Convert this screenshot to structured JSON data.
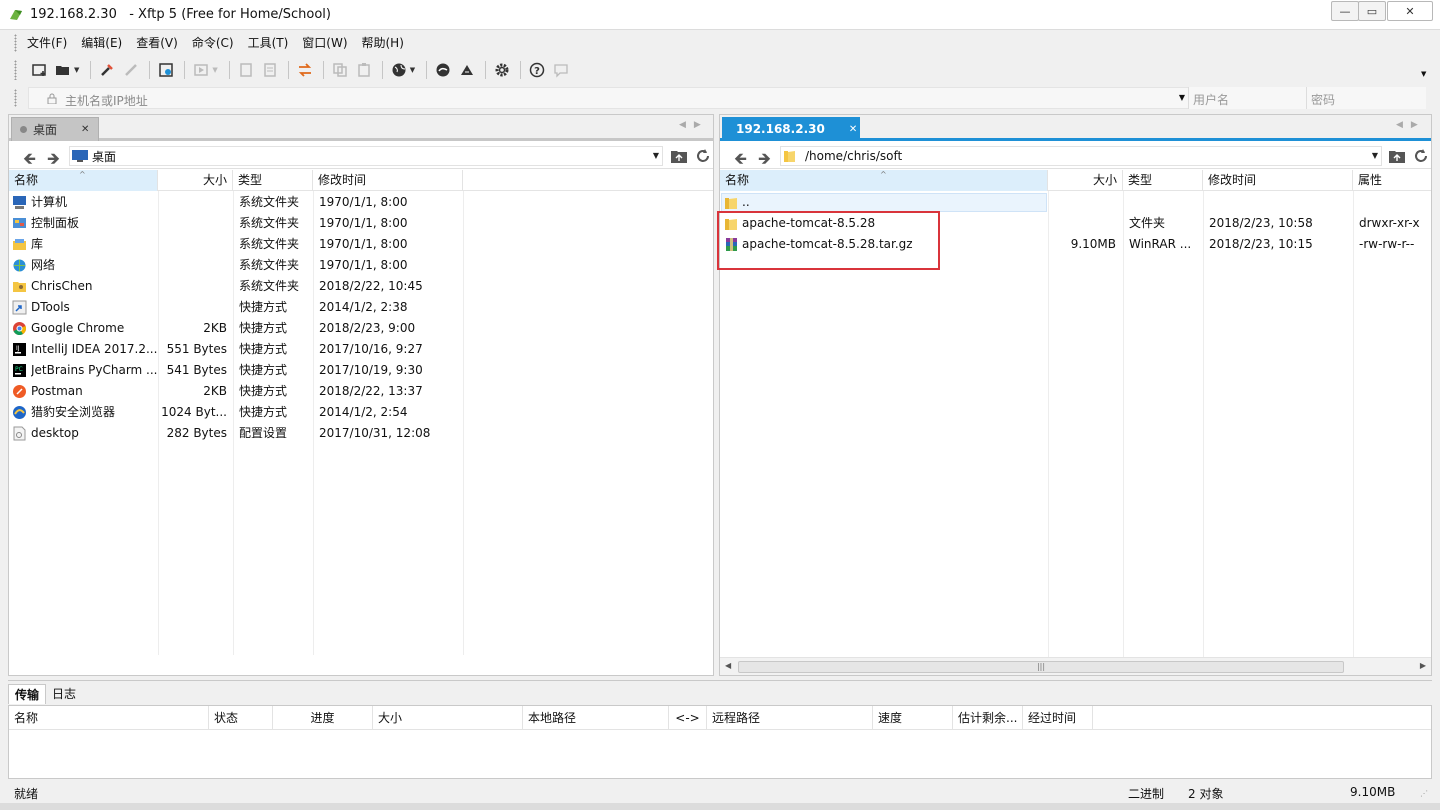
{
  "window": {
    "title": "192.168.2.30   - Xftp 5 (Free for Home/School)",
    "buttons": {
      "minimize": "—",
      "restore": "▭",
      "close": "✕"
    }
  },
  "menu": [
    "文件(F)",
    "编辑(E)",
    "查看(V)",
    "命令(C)",
    "工具(T)",
    "窗口(W)",
    "帮助(H)"
  ],
  "toolbar": {
    "icons": [
      "new-session-icon",
      "open-folder-icon",
      "connect-icon",
      "disconnect-icon",
      "properties-icon",
      "run-icon",
      "copy-doc-icon",
      "paste-doc-icon",
      "transfer-icon",
      "duplicate-icon",
      "clipboard-icon",
      "globe-icon",
      "terminal-icon",
      "xshell-icon",
      "gear-icon",
      "help-icon",
      "chat-icon"
    ]
  },
  "address": {
    "host_placeholder": "主机名或IP地址",
    "user_placeholder": "用户名",
    "pass_placeholder": "密码"
  },
  "left": {
    "tab_label": "桌面",
    "path": "桌面",
    "columns": [
      "名称",
      "大小",
      "类型",
      "修改时间"
    ],
    "rows": [
      {
        "name": "计算机",
        "size": "",
        "type": "系统文件夹",
        "mtime": "1970/1/1, 8:00",
        "icon": "computer-icon"
      },
      {
        "name": "控制面板",
        "size": "",
        "type": "系统文件夹",
        "mtime": "1970/1/1, 8:00",
        "icon": "control-panel-icon"
      },
      {
        "name": "库",
        "size": "",
        "type": "系统文件夹",
        "mtime": "1970/1/1, 8:00",
        "icon": "library-icon"
      },
      {
        "name": "网络",
        "size": "",
        "type": "系统文件夹",
        "mtime": "1970/1/1, 8:00",
        "icon": "network-icon"
      },
      {
        "name": "ChrisChen",
        "size": "",
        "type": "系统文件夹",
        "mtime": "2018/2/22, 10:45",
        "icon": "user-folder-icon"
      },
      {
        "name": "DTools",
        "size": "",
        "type": "快捷方式",
        "mtime": "2014/1/2, 2:38",
        "icon": "shortcut-icon"
      },
      {
        "name": "Google Chrome",
        "size": "2KB",
        "type": "快捷方式",
        "mtime": "2018/2/23, 9:00",
        "icon": "chrome-icon"
      },
      {
        "name": "IntelliJ IDEA 2017.2....",
        "size": "551 Bytes",
        "type": "快捷方式",
        "mtime": "2017/10/16, 9:27",
        "icon": "intellij-icon"
      },
      {
        "name": "JetBrains PyCharm ...",
        "size": "541 Bytes",
        "type": "快捷方式",
        "mtime": "2017/10/19, 9:30",
        "icon": "pycharm-icon"
      },
      {
        "name": "Postman",
        "size": "2KB",
        "type": "快捷方式",
        "mtime": "2018/2/22, 13:37",
        "icon": "postman-icon"
      },
      {
        "name": "猎豹安全浏览器",
        "size": "1024 Byt...",
        "type": "快捷方式",
        "mtime": "2014/1/2, 2:54",
        "icon": "browser-icon"
      },
      {
        "name": "desktop",
        "size": "282 Bytes",
        "type": "配置设置",
        "mtime": "2017/10/31, 12:08",
        "icon": "config-file-icon"
      }
    ]
  },
  "right": {
    "tab_label": "192.168.2.30",
    "path": "/home/chris/soft",
    "columns": [
      "名称",
      "大小",
      "类型",
      "修改时间",
      "属性"
    ],
    "rows": [
      {
        "name": "..",
        "size": "",
        "type": "",
        "mtime": "",
        "attr": "",
        "icon": "folder-icon"
      },
      {
        "name": "apache-tomcat-8.5.28",
        "size": "",
        "type": "文件夹",
        "mtime": "2018/2/23, 10:58",
        "attr": "drwxr-xr-x",
        "icon": "folder-icon"
      },
      {
        "name": "apache-tomcat-8.5.28.tar.gz",
        "size": "9.10MB",
        "type": "WinRAR ...",
        "mtime": "2018/2/23, 10:15",
        "attr": "-rw-rw-r--",
        "icon": "winrar-icon"
      }
    ]
  },
  "transfer": {
    "tabs": [
      "传输",
      "日志"
    ],
    "columns": [
      "名称",
      "状态",
      "进度",
      "大小",
      "本地路径",
      "<->",
      "远程路径",
      "速度",
      "估计剩余...",
      "经过时间"
    ]
  },
  "status": {
    "left": "就绪",
    "mode": "二进制",
    "objects": "2 对象",
    "size": "9.10MB"
  },
  "colors": {
    "accent": "#1e90d6",
    "highlight_box": "#d9343b",
    "connected_dot": "#2ecc40"
  }
}
